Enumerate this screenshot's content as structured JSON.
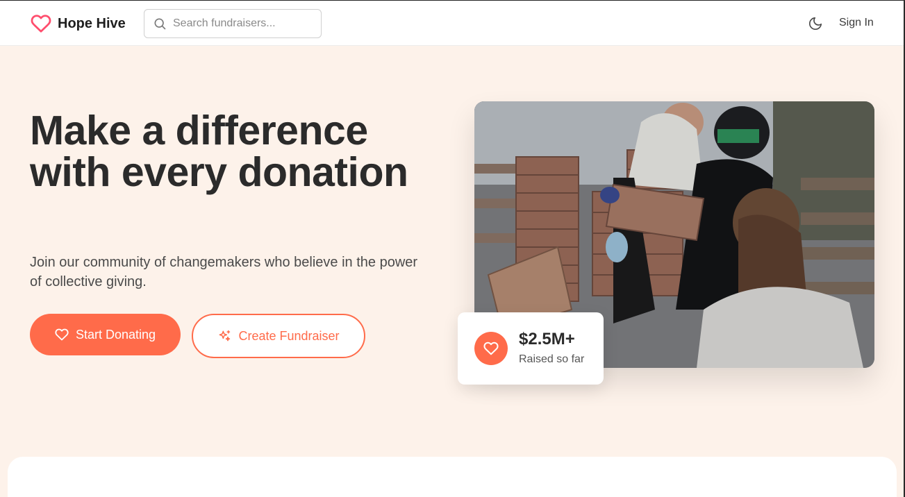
{
  "header": {
    "brand": "Hope Hive",
    "search_placeholder": "Search fundraisers...",
    "sign_in_label": "Sign In"
  },
  "hero": {
    "title": "Make a difference with every donation",
    "subtitle": "Join our community of changemakers who believe in the power of collective giving.",
    "primary_button": "Start Donating",
    "secondary_button": "Create Fundraiser"
  },
  "stat": {
    "value": "$2.5M+",
    "label": "Raised so far"
  },
  "icons": {
    "logo": "heart-icon",
    "search": "search-icon",
    "theme": "moon-icon",
    "primary": "heart-icon",
    "secondary": "sparkles-icon",
    "stat": "heart-icon"
  },
  "colors": {
    "accent": "#ff6b4a",
    "background": "#fdf2ea",
    "text": "#2b2b2b"
  }
}
